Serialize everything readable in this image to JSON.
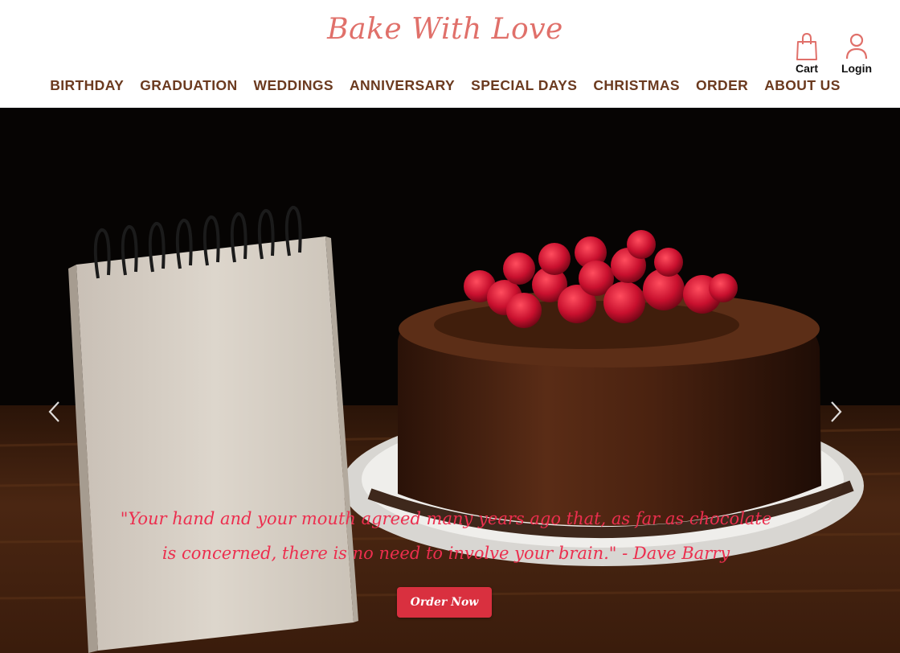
{
  "brand": {
    "name": "Bake With Love",
    "color": "#e0706a"
  },
  "header": {
    "cart": {
      "label": "Cart",
      "icon": "shopping-bag-icon"
    },
    "login": {
      "label": "Login",
      "icon": "user-icon"
    }
  },
  "nav": {
    "items": [
      {
        "label": "BIRTHDAY"
      },
      {
        "label": "GRADUATION"
      },
      {
        "label": "WEDDINGS"
      },
      {
        "label": "ANNIVERSARY"
      },
      {
        "label": "SPECIAL DAYS"
      },
      {
        "label": "CHRISTMAS"
      },
      {
        "label": "ORDER"
      },
      {
        "label": "ABOUT US"
      }
    ],
    "color": "#6b3a1f"
  },
  "hero": {
    "quote_line1": "\"Your hand and your mouth agreed many years ago that, as far as chocolate",
    "quote_line2": "is concerned, there is no need to involve your brain.\" - Dave Barry",
    "quote_color": "#ec2e4e",
    "cta_label": "Order Now",
    "cta_color": "#d9303f",
    "prev_icon": "chevron-left-icon",
    "next_icon": "chevron-right-icon"
  }
}
